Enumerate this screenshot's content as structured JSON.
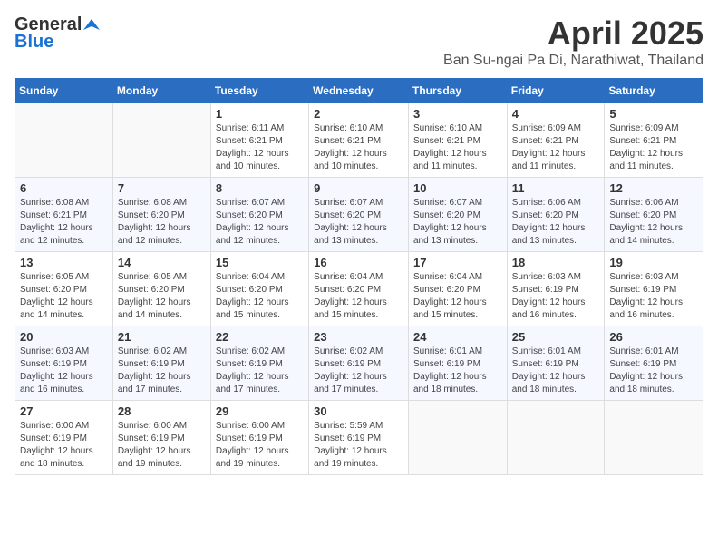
{
  "header": {
    "logo_general": "General",
    "logo_blue": "Blue",
    "title": "April 2025",
    "location": "Ban Su-ngai Pa Di, Narathiwat, Thailand"
  },
  "weekdays": [
    "Sunday",
    "Monday",
    "Tuesday",
    "Wednesday",
    "Thursday",
    "Friday",
    "Saturday"
  ],
  "weeks": [
    [
      {
        "day": "",
        "info": ""
      },
      {
        "day": "",
        "info": ""
      },
      {
        "day": "1",
        "info": "Sunrise: 6:11 AM\nSunset: 6:21 PM\nDaylight: 12 hours\nand 10 minutes."
      },
      {
        "day": "2",
        "info": "Sunrise: 6:10 AM\nSunset: 6:21 PM\nDaylight: 12 hours\nand 10 minutes."
      },
      {
        "day": "3",
        "info": "Sunrise: 6:10 AM\nSunset: 6:21 PM\nDaylight: 12 hours\nand 11 minutes."
      },
      {
        "day": "4",
        "info": "Sunrise: 6:09 AM\nSunset: 6:21 PM\nDaylight: 12 hours\nand 11 minutes."
      },
      {
        "day": "5",
        "info": "Sunrise: 6:09 AM\nSunset: 6:21 PM\nDaylight: 12 hours\nand 11 minutes."
      }
    ],
    [
      {
        "day": "6",
        "info": "Sunrise: 6:08 AM\nSunset: 6:21 PM\nDaylight: 12 hours\nand 12 minutes."
      },
      {
        "day": "7",
        "info": "Sunrise: 6:08 AM\nSunset: 6:20 PM\nDaylight: 12 hours\nand 12 minutes."
      },
      {
        "day": "8",
        "info": "Sunrise: 6:07 AM\nSunset: 6:20 PM\nDaylight: 12 hours\nand 12 minutes."
      },
      {
        "day": "9",
        "info": "Sunrise: 6:07 AM\nSunset: 6:20 PM\nDaylight: 12 hours\nand 13 minutes."
      },
      {
        "day": "10",
        "info": "Sunrise: 6:07 AM\nSunset: 6:20 PM\nDaylight: 12 hours\nand 13 minutes."
      },
      {
        "day": "11",
        "info": "Sunrise: 6:06 AM\nSunset: 6:20 PM\nDaylight: 12 hours\nand 13 minutes."
      },
      {
        "day": "12",
        "info": "Sunrise: 6:06 AM\nSunset: 6:20 PM\nDaylight: 12 hours\nand 14 minutes."
      }
    ],
    [
      {
        "day": "13",
        "info": "Sunrise: 6:05 AM\nSunset: 6:20 PM\nDaylight: 12 hours\nand 14 minutes."
      },
      {
        "day": "14",
        "info": "Sunrise: 6:05 AM\nSunset: 6:20 PM\nDaylight: 12 hours\nand 14 minutes."
      },
      {
        "day": "15",
        "info": "Sunrise: 6:04 AM\nSunset: 6:20 PM\nDaylight: 12 hours\nand 15 minutes."
      },
      {
        "day": "16",
        "info": "Sunrise: 6:04 AM\nSunset: 6:20 PM\nDaylight: 12 hours\nand 15 minutes."
      },
      {
        "day": "17",
        "info": "Sunrise: 6:04 AM\nSunset: 6:20 PM\nDaylight: 12 hours\nand 15 minutes."
      },
      {
        "day": "18",
        "info": "Sunrise: 6:03 AM\nSunset: 6:19 PM\nDaylight: 12 hours\nand 16 minutes."
      },
      {
        "day": "19",
        "info": "Sunrise: 6:03 AM\nSunset: 6:19 PM\nDaylight: 12 hours\nand 16 minutes."
      }
    ],
    [
      {
        "day": "20",
        "info": "Sunrise: 6:03 AM\nSunset: 6:19 PM\nDaylight: 12 hours\nand 16 minutes."
      },
      {
        "day": "21",
        "info": "Sunrise: 6:02 AM\nSunset: 6:19 PM\nDaylight: 12 hours\nand 17 minutes."
      },
      {
        "day": "22",
        "info": "Sunrise: 6:02 AM\nSunset: 6:19 PM\nDaylight: 12 hours\nand 17 minutes."
      },
      {
        "day": "23",
        "info": "Sunrise: 6:02 AM\nSunset: 6:19 PM\nDaylight: 12 hours\nand 17 minutes."
      },
      {
        "day": "24",
        "info": "Sunrise: 6:01 AM\nSunset: 6:19 PM\nDaylight: 12 hours\nand 18 minutes."
      },
      {
        "day": "25",
        "info": "Sunrise: 6:01 AM\nSunset: 6:19 PM\nDaylight: 12 hours\nand 18 minutes."
      },
      {
        "day": "26",
        "info": "Sunrise: 6:01 AM\nSunset: 6:19 PM\nDaylight: 12 hours\nand 18 minutes."
      }
    ],
    [
      {
        "day": "27",
        "info": "Sunrise: 6:00 AM\nSunset: 6:19 PM\nDaylight: 12 hours\nand 18 minutes."
      },
      {
        "day": "28",
        "info": "Sunrise: 6:00 AM\nSunset: 6:19 PM\nDaylight: 12 hours\nand 19 minutes."
      },
      {
        "day": "29",
        "info": "Sunrise: 6:00 AM\nSunset: 6:19 PM\nDaylight: 12 hours\nand 19 minutes."
      },
      {
        "day": "30",
        "info": "Sunrise: 5:59 AM\nSunset: 6:19 PM\nDaylight: 12 hours\nand 19 minutes."
      },
      {
        "day": "",
        "info": ""
      },
      {
        "day": "",
        "info": ""
      },
      {
        "day": "",
        "info": ""
      }
    ]
  ]
}
